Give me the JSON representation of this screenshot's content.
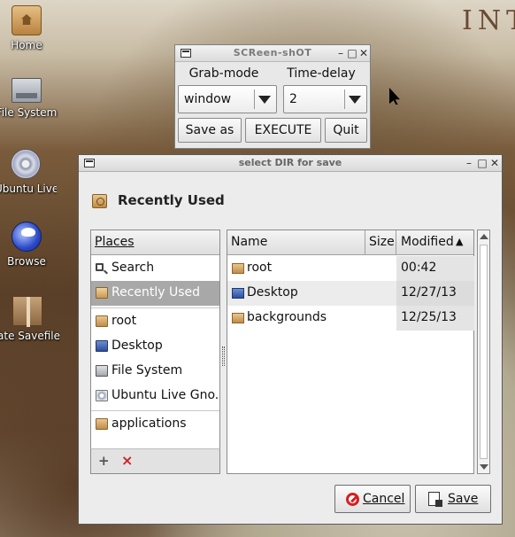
{
  "desktop": {
    "wall_text": "INT",
    "icons": [
      {
        "label": "Home",
        "icon": "home-folder-icon"
      },
      {
        "label": "File System",
        "icon": "drive-icon"
      },
      {
        "label": "Ubuntu Live ...",
        "icon": "disc-icon"
      },
      {
        "label": "Browse",
        "icon": "globe-icon"
      },
      {
        "label": "Create Savefile",
        "icon": "package-icon"
      }
    ]
  },
  "screenshot_tool": {
    "title": "SCReen-shOT",
    "grab_mode_label": "Grab-mode",
    "time_delay_label": "Time-delay",
    "grab_mode_value": "window",
    "time_delay_value": "2",
    "buttons": {
      "save_as": "Save as",
      "execute": "EXECUTE",
      "quit": "Quit"
    }
  },
  "dialog": {
    "title": "select DIR for save",
    "location": "Recently Used",
    "places_header": "Places",
    "places": [
      {
        "label": "Search",
        "icon": "search-icon",
        "selected": false
      },
      {
        "label": "Recently Used",
        "icon": "recent-icon",
        "selected": true
      },
      {
        "label": "root",
        "icon": "folder-icon",
        "selected": false
      },
      {
        "label": "Desktop",
        "icon": "desktop-icon",
        "selected": false
      },
      {
        "label": "File System",
        "icon": "drive-icon",
        "selected": false
      },
      {
        "label": "Ubuntu Live Gno...",
        "icon": "disc-icon",
        "selected": false
      },
      {
        "label": "applications",
        "icon": "folder-icon",
        "selected": false
      }
    ],
    "places_footer": {
      "add": "+",
      "remove": "×"
    },
    "columns": {
      "name": "Name",
      "size": "Size",
      "modified": "Modified",
      "sort_indicator": "▲"
    },
    "files": [
      {
        "name": "root",
        "icon": "folder-icon",
        "size": "",
        "modified": "00:42"
      },
      {
        "name": "Desktop",
        "icon": "desktop-icon",
        "size": "",
        "modified": "12/27/13"
      },
      {
        "name": "backgrounds",
        "icon": "folder-icon",
        "size": "",
        "modified": "12/25/13"
      }
    ],
    "buttons": {
      "cancel": "Cancel",
      "save": "Save"
    }
  },
  "colors": {
    "selection": "#a8a8a8",
    "cancel_icon": "#d42020"
  }
}
